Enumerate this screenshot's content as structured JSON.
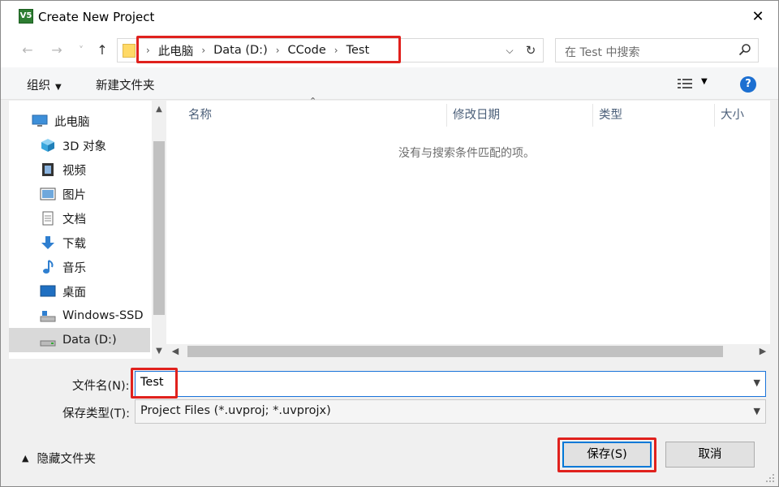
{
  "window": {
    "app_icon_text": "V5",
    "title": "Create New Project",
    "close_glyph": "✕"
  },
  "address_bar": {
    "back_glyph": "←",
    "forward_glyph": "→",
    "recent_glyph": "˅",
    "up_glyph": "↑",
    "crumbs": [
      "此电脑",
      "Data (D:)",
      "CCode",
      "Test"
    ],
    "separator": "›",
    "dropdown_glyph": "⌵",
    "refresh_glyph": "↻"
  },
  "search": {
    "placeholder": "在 Test 中搜索"
  },
  "toolbar": {
    "organize_label": "组织",
    "new_folder_label": "新建文件夹",
    "help_glyph": "?"
  },
  "nav_pane": {
    "items": [
      {
        "label": "此电脑",
        "icon": "computer-icon"
      },
      {
        "label": "3D 对象",
        "icon": "cube-icon"
      },
      {
        "label": "视频",
        "icon": "video-icon"
      },
      {
        "label": "图片",
        "icon": "picture-icon"
      },
      {
        "label": "文档",
        "icon": "document-icon"
      },
      {
        "label": "下载",
        "icon": "download-icon"
      },
      {
        "label": "音乐",
        "icon": "music-icon"
      },
      {
        "label": "桌面",
        "icon": "desktop-icon"
      },
      {
        "label": "Windows-SSD",
        "icon": "drive-icon"
      },
      {
        "label": "Data (D:)",
        "icon": "drive-icon"
      }
    ],
    "selected_index": 9
  },
  "list_pane": {
    "columns": [
      "名称",
      "修改日期",
      "类型",
      "大小"
    ],
    "empty_message": "没有与搜索条件匹配的项。"
  },
  "form": {
    "filename_label": "文件名(N):",
    "filename_value": "Test",
    "filetype_label": "保存类型(T):",
    "filetype_value": "Project Files (*.uvproj; *.uvprojx)"
  },
  "footer": {
    "hide_folders_label": "隐藏文件夹",
    "save_label": "保存(S)",
    "cancel_label": "取消"
  },
  "colors": {
    "highlight": "#e0211d",
    "accent": "#0078d7"
  }
}
